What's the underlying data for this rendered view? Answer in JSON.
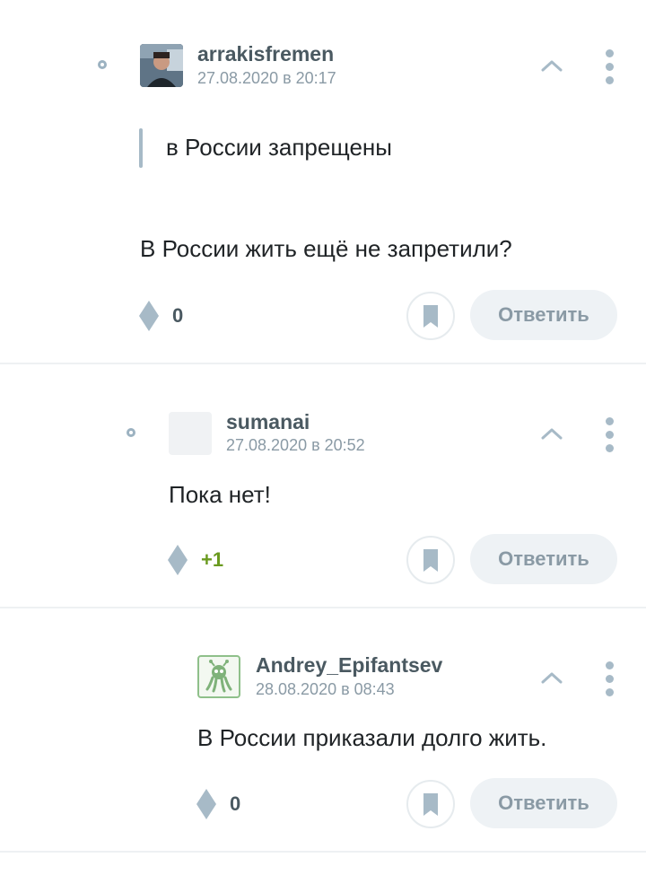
{
  "comments": [
    {
      "username": "arrakisfremen",
      "date": "27.08.2020 в 20:17",
      "quote": "в России запрещены",
      "text": "В России жить ещё не запретили?",
      "score": "0",
      "score_color": "#4a5961",
      "reply_label": "Ответить"
    },
    {
      "username": "sumanai",
      "date": "27.08.2020 в 20:52",
      "text": "Пока нет!",
      "score": "+1",
      "score_color": "#6a9a1f",
      "reply_label": "Ответить"
    },
    {
      "username": "Andrey_Epifantsev",
      "date": "28.08.2020 в 08:43",
      "text": "В России приказали долго жить.",
      "score": "0",
      "score_color": "#4a5961",
      "reply_label": "Ответить"
    }
  ],
  "icons": {
    "collapse": "chevron-up-icon",
    "more": "vertical-dots-icon",
    "vote": "diamond-score-icon",
    "bookmark": "bookmark-icon"
  },
  "colors": {
    "accent_gray": "#a7bac7",
    "positive": "#6a9a1f"
  }
}
